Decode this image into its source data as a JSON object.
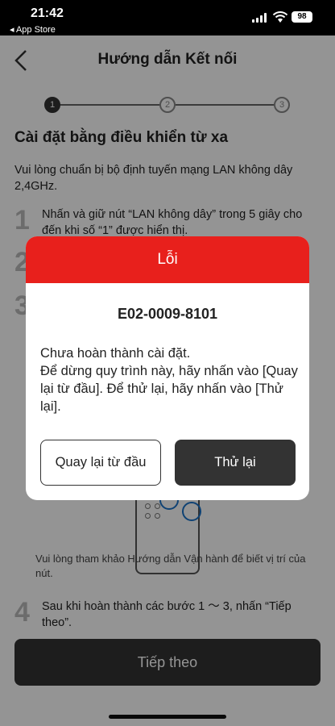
{
  "status_bar": {
    "time": "21:42",
    "back_label": "◂ App Store",
    "battery": "98"
  },
  "nav": {
    "title": "Hướng dẫn Kết nối"
  },
  "stepper": {
    "steps": [
      "1",
      "2",
      "3"
    ],
    "current": 1
  },
  "main": {
    "section_title": "Cài đặt bằng điều khiển từ xa",
    "intro": "Vui lòng chuẩn bị bộ định tuyến mạng LAN không dây 2,4GHz.",
    "steps": [
      {
        "num": "1",
        "text": "Nhấn và giữ nút “LAN không dây” trong 5 giây cho đến khi số “1” được hiển thị."
      },
      {
        "num": "2",
        "text": ""
      },
      {
        "num": "3",
        "text": ""
      },
      {
        "num": "4",
        "text": "Sau khi hoàn thành các bước 1 ～ 3, nhấn “Tiếp theo”."
      }
    ],
    "note": "Vui lòng tham khảo Hướng dẫn Vận hành để biết vị trí của nút.",
    "next_button": "Tiếp theo"
  },
  "dialog": {
    "header": "Lỗi",
    "error_code": "E02-0009-8101",
    "message": "Chưa hoàn thành cài đặt.\nĐể dừng quy trình này, hãy nhấn vào [Quay lại từ đầu]. Để thử lại, hãy nhấn vào [Thử lại].",
    "restart_button": "Quay lại từ đầu",
    "retry_button": "Thử lại"
  },
  "colors": {
    "error_red": "#e8201c",
    "button_dark": "#333333",
    "highlight_blue": "#1a73c8"
  }
}
